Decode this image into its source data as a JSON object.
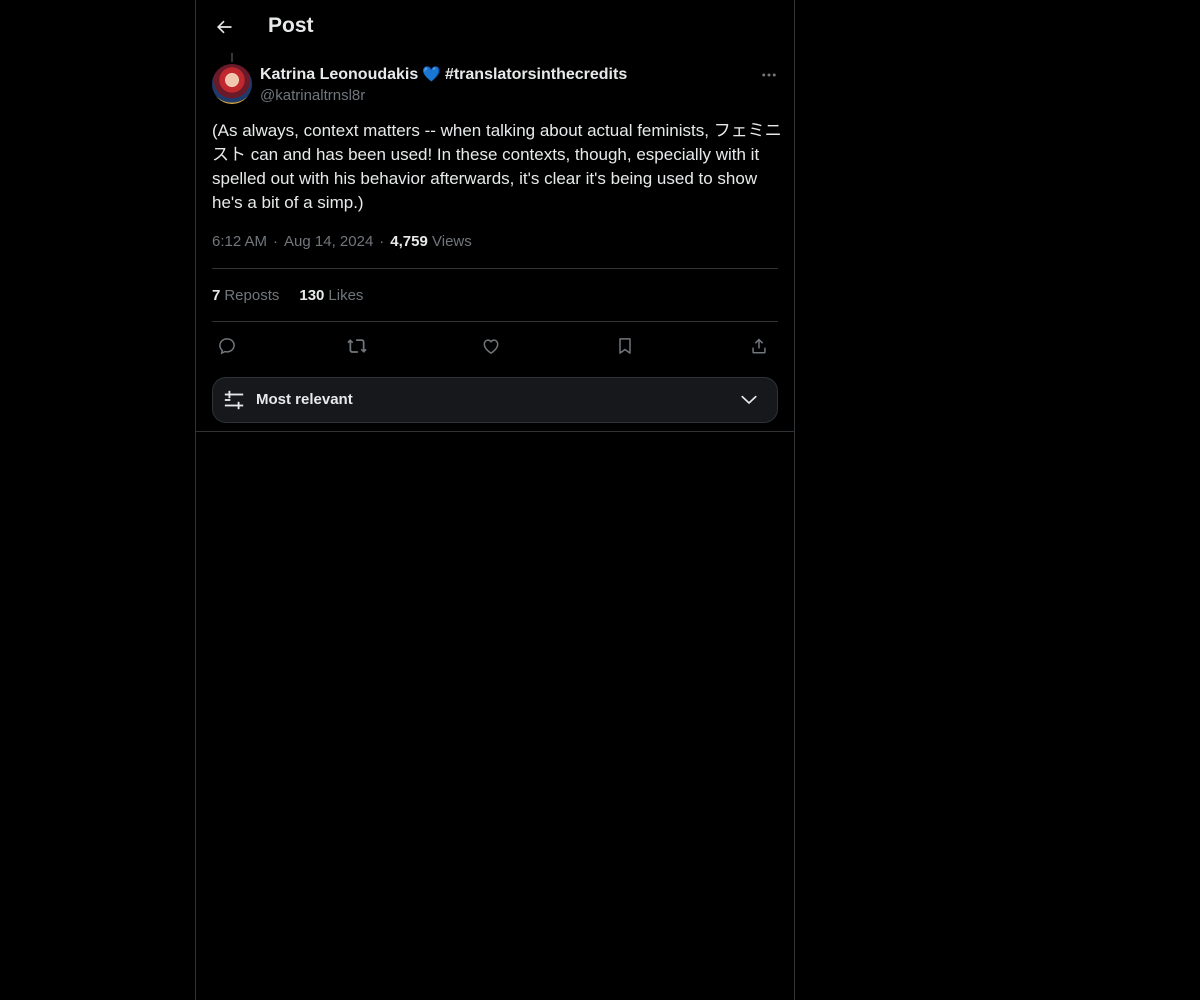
{
  "header": {
    "title": "Post"
  },
  "post": {
    "author_name": "Katrina Leonoudakis",
    "author_badge": "💙",
    "author_hashtag": "#translatorsinthecredits",
    "handle": "@katrinaltrnsl8r",
    "text": "(As always, context matters -- when talking about actual feminists, フェミニスト can and has been used! In these contexts, though, especially with it spelled out with his behavior afterwards, it's clear it's being used to show he's a bit of a simp.)",
    "time": "6:12 AM",
    "separator": "·",
    "date": "Aug 14, 2024",
    "views_count": "4,759",
    "views_label": "Views"
  },
  "stats": {
    "reposts_count": "7",
    "reposts_label": "Reposts",
    "likes_count": "130",
    "likes_label": "Likes"
  },
  "actions": [
    "reply-icon",
    "repost-icon",
    "like-icon",
    "bookmark-icon",
    "share-icon"
  ],
  "sort": {
    "label": "Most relevant"
  },
  "colors": {
    "background": "#000000",
    "border": "#2f3336",
    "text_primary": "#e7e9ea",
    "text_secondary": "#71767b",
    "badge_heart": "#5ba9e6",
    "sort_bar_bg": "#16181c"
  }
}
